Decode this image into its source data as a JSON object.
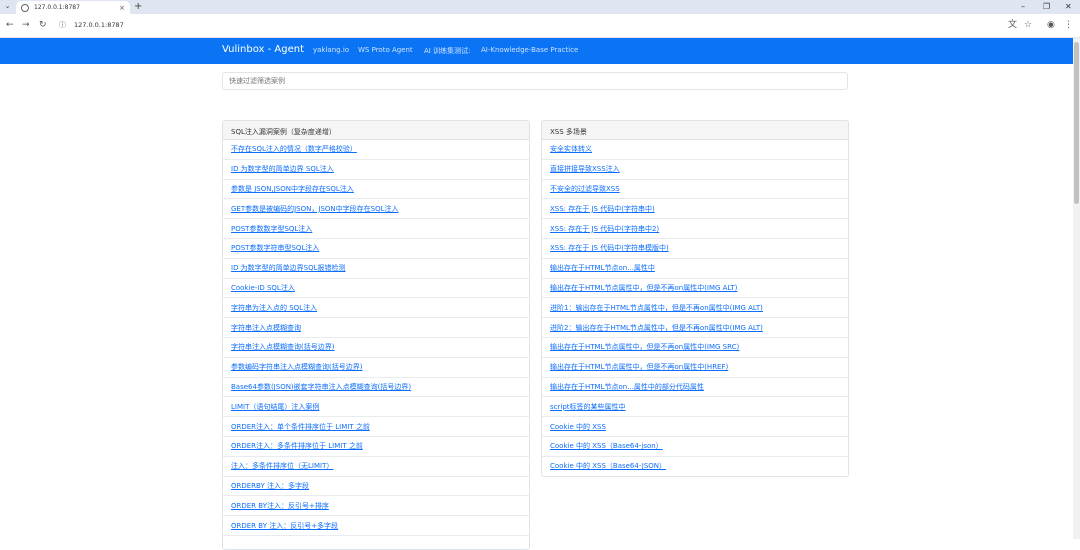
{
  "browser": {
    "tab_title": "127.0.0.1:8787",
    "tab_close": "×",
    "new_tab": "+",
    "address": "127.0.0.1:8787"
  },
  "navbar": {
    "brand": "Vulinbox - Agent",
    "links": [
      "yaklang.io",
      "WS Proto Agent",
      "AI 训练集测试:",
      "AI-Knowledge-Base Practice"
    ]
  },
  "filter": {
    "placeholder": "快速过滤筛选案例"
  },
  "sql_card": {
    "header": "SQL注入漏洞案例（复杂度递增）",
    "items": [
      "不存在SQL注入的情况（数字严格校验）",
      "ID 为数字型的简单边界 SQL注入",
      "参数是 JSON,JSON中字段存在SQL注入",
      "GET参数是被编码的JSON，JSON中字段存在SQL注入",
      "POST参数数字型SQL注入",
      "POST参数字符串型SQL注入",
      "ID 为数字型的简单边界SQL报错检测",
      "Cookie-ID SQL注入",
      "字符串为注入点的 SQL注入",
      "字符串注入点模糊查询",
      "字符串注入点模糊查询(括号边界)",
      "参数编码字符串注入点模糊查询(括号边界)",
      "Base64参数(JSON)嵌套字符串注入点模糊查询(括号边界)",
      "LIMIT（语句结尾）注入案例",
      "ORDER注入：单个条件排序位于 LIMIT 之前",
      "ORDER注入：多条件排序位于 LIMIT 之前",
      "注入：多条件排序位（无LIMIT）",
      "ORDERBY 注入：多字段",
      "ORDER BY注入：反引号+排序",
      "ORDER BY 注入：反引号+多字段"
    ]
  },
  "xss_card": {
    "header": "XSS 多场景",
    "items": [
      "安全实体转义",
      "直接拼接导致XSS注入",
      "不安全的过滤导致XSS",
      "XSS: 存在于 JS 代码中(字符串中)",
      "XSS: 存在于 JS 代码中(字符串中2)",
      "XSS: 存在于 JS 代码中(字符串模版中)",
      "输出存在于HTML节点on...属性中",
      "输出存在于HTML节点属性中，但是不再on属性中(IMG ALT)",
      "进阶1：输出存在于HTML节点属性中，但是不再on属性中(IMG ALT)",
      "进阶2：输出存在于HTML节点属性中，但是不再on属性中(IMG ALT)",
      "输出存在于HTML节点属性中，但是不再on属性中(IMG SRC)",
      "输出存在于HTML节点属性中，但是不再on属性中(HREF)",
      "输出存在于HTML节点on...属性中的部分代码属性",
      "script标签的某些属性中",
      "Cookie 中的 XSS",
      "Cookie 中的 XSS（Base64-json）",
      "Cookie 中的 XSS（Base64-JSON）"
    ]
  }
}
